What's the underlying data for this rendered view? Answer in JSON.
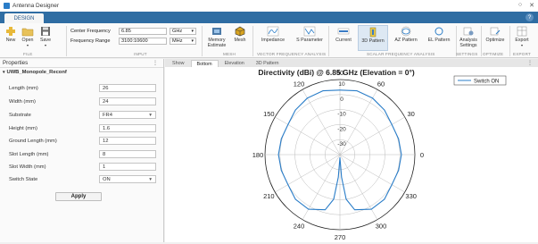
{
  "window": {
    "title": "Antenna Designer",
    "minimize": "○",
    "close": "✕"
  },
  "ribbon": {
    "tab": "DESIGN",
    "help": "?"
  },
  "file_group": {
    "new": "New",
    "open": "Open",
    "save": "Save",
    "label": "FILE"
  },
  "input_group": {
    "center_frequency_label": "Center Frequency",
    "center_frequency_value": "6.85",
    "center_frequency_unit": "GHz",
    "frequency_range_label": "Frequency Range",
    "frequency_range_value": "3100:10600",
    "frequency_range_unit": "MHz",
    "label": "INPUT"
  },
  "mesh_group": {
    "memory": "Memory",
    "estimate": "Estimate",
    "mesh": "Mesh",
    "label": "MESH"
  },
  "vfa_group": {
    "impedance": "Impedance",
    "sparam": "S Parameter",
    "label": "VECTOR FREQUENCY ANALYSIS"
  },
  "sfa_group": {
    "current": "Current",
    "pattern3d": "3D Pattern",
    "azpattern": "AZ Pattern",
    "elpattern": "EL Pattern",
    "label": "SCALAR FREQUENCY ANALYSIS"
  },
  "settings_group": {
    "analysis": "Analysis",
    "settings": "Settings",
    "label": "SETTINGS"
  },
  "optimize_group": {
    "optimize": "Optimize",
    "label": "OPTIMIZE"
  },
  "export_group": {
    "export": "Export",
    "label": "EXPORT"
  },
  "properties": {
    "title": "Properties",
    "menu": "⋮",
    "object": "UWB_Monopole_Reconf",
    "fields": [
      {
        "label": "Length (mm)",
        "value": "26"
      },
      {
        "label": "Width (mm)",
        "value": "24"
      },
      {
        "label": "Substrate",
        "value": "FR4"
      },
      {
        "label": "Height (mm)",
        "value": "1.6"
      },
      {
        "label": "Ground Length (mm)",
        "value": "12"
      },
      {
        "label": "Slot Length (mm)",
        "value": "8"
      },
      {
        "label": "Slot Width (mm)",
        "value": "1"
      },
      {
        "label": "Switch State",
        "value": "ON"
      }
    ],
    "apply": "Apply"
  },
  "plot_tabs": [
    "Show",
    "Bottom",
    "Elevation",
    "3D Pattern"
  ],
  "plot_menu": "⋮",
  "chart_data": {
    "type": "polar",
    "title": "Directivity (dBi) @ 6.85 GHz (Elevation =  0°)",
    "legend": "Switch ON",
    "legend_position": "top-right",
    "line_color": "#2a7dc8",
    "radial_ticks": [
      "10",
      "0",
      "-10",
      "-20",
      "-30"
    ],
    "radial_values": [
      10,
      0,
      -10,
      -20,
      -30
    ],
    "r_min": -40,
    "r_max": 10,
    "angle_labels": [
      "0",
      "30",
      "60",
      "90",
      "120",
      "150",
      "180",
      "210",
      "240",
      "270",
      "300",
      "330"
    ],
    "angles_deg": [
      0,
      15,
      30,
      45,
      60,
      75,
      90,
      105,
      120,
      135,
      150,
      165,
      180,
      195,
      210,
      225,
      240,
      255,
      262,
      266,
      270,
      274,
      278,
      285,
      300,
      315,
      330,
      345,
      360
    ],
    "directivity_dbi": [
      1.0,
      0.5,
      0.0,
      2.0,
      3.5,
      4.0,
      3.0,
      4.0,
      3.5,
      2.0,
      0.0,
      0.5,
      1.0,
      0.5,
      0.0,
      2.0,
      2.0,
      -2.0,
      -10.0,
      -25.0,
      -38.0,
      -25.0,
      -10.0,
      -2.0,
      2.0,
      2.0,
      0.0,
      0.5,
      1.0
    ]
  }
}
